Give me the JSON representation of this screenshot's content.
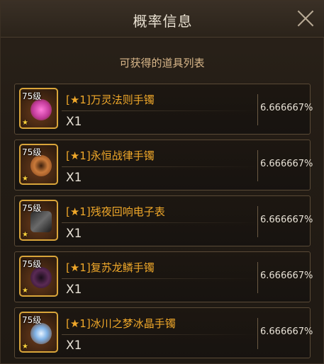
{
  "header": {
    "title": "概率信息"
  },
  "subtitle": "可获得的道具列表",
  "items": [
    {
      "level": "75级",
      "star": "★",
      "name": "[★1]万灵法则手镯",
      "qty": "X1",
      "probability": "6.666667%",
      "icon": "bracelet-icon",
      "accent": "#e64bb1"
    },
    {
      "level": "75级",
      "star": "★",
      "name": "[★1]永恒战律手镯",
      "qty": "X1",
      "probability": "6.666667%",
      "icon": "bracelet-icon",
      "accent": "#b5642a"
    },
    {
      "level": "75级",
      "star": "★",
      "name": "[★1]残夜回响电子表",
      "qty": "X1",
      "probability": "6.666667%",
      "icon": "watch-icon",
      "accent": "#5a5a5a"
    },
    {
      "level": "75级",
      "star": "★",
      "name": "[★1]复苏龙鳞手镯",
      "qty": "X1",
      "probability": "6.666667%",
      "icon": "bracelet-icon",
      "accent": "#5a2a55"
    },
    {
      "level": "75级",
      "star": "★",
      "name": "[★1]冰川之梦冰晶手镯",
      "qty": "X1",
      "probability": "6.666667%",
      "icon": "bracelet-icon",
      "accent": "#7fb2e6"
    }
  ]
}
